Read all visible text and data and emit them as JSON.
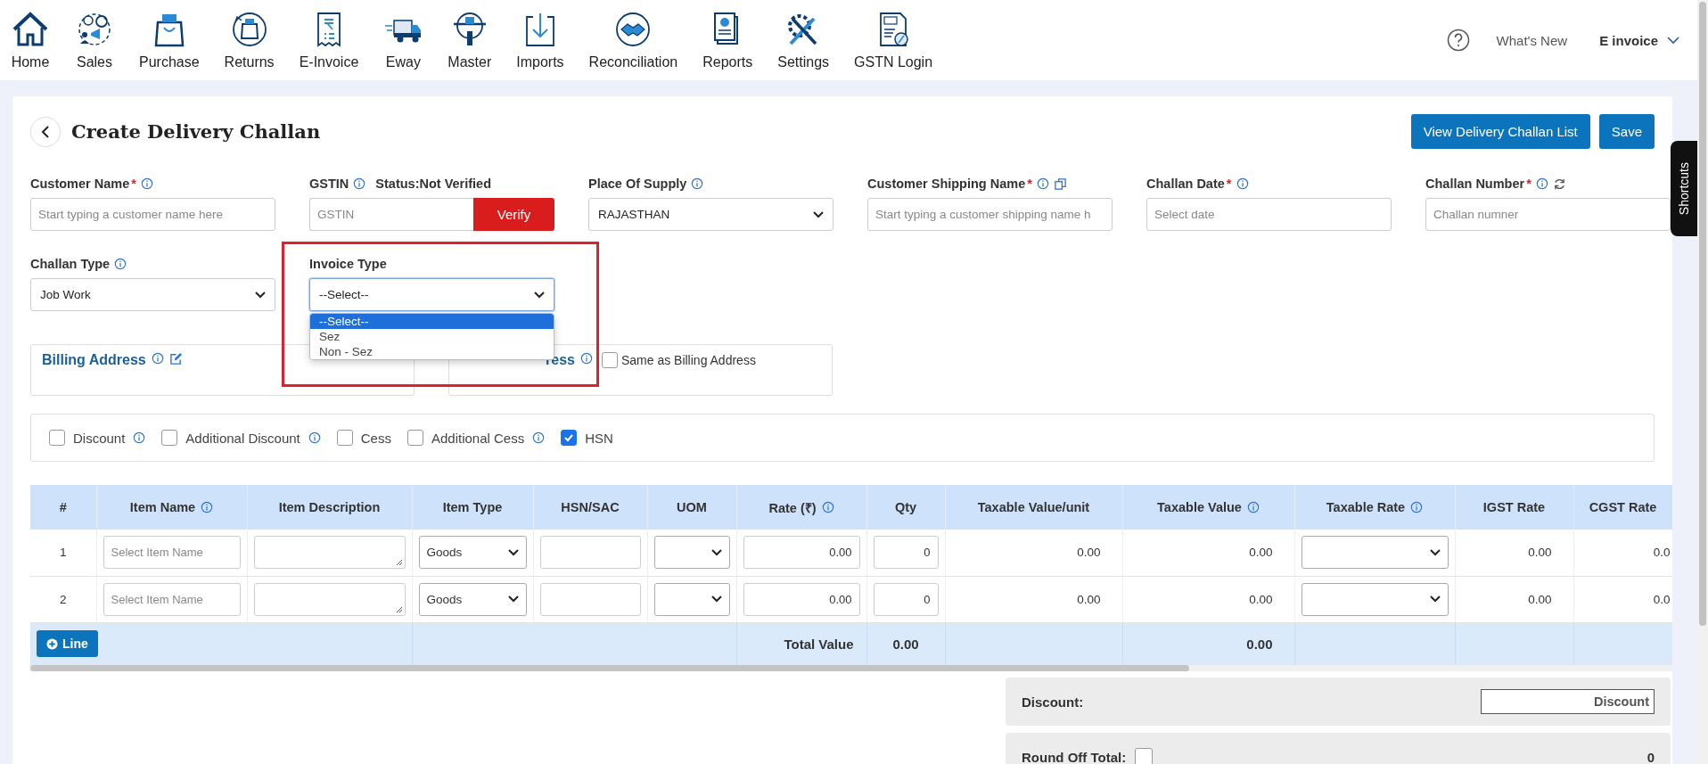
{
  "nav": {
    "items": [
      {
        "label": "Home"
      },
      {
        "label": "Sales"
      },
      {
        "label": "Purchase"
      },
      {
        "label": "Returns"
      },
      {
        "label": "E-Invoice"
      },
      {
        "label": "Eway"
      },
      {
        "label": "Master"
      },
      {
        "label": "Imports"
      },
      {
        "label": "Reconciliation"
      },
      {
        "label": "Reports"
      },
      {
        "label": "Settings"
      },
      {
        "label": "GSTN Login"
      }
    ],
    "help_link": "What's New",
    "account": "E invoice"
  },
  "page": {
    "title": "Create Delivery Challan",
    "buttons": [
      {
        "label": "View Delivery Challan List"
      },
      {
        "label": "Save"
      }
    ]
  },
  "fields": [
    {
      "kind": "text",
      "label": "Customer Name",
      "required_mark": "*",
      "info": true,
      "placeholder": "Start typing a customer name here"
    },
    {
      "kind": "gstin",
      "label": "GSTIN",
      "info": true,
      "status": "Status:Not Verified",
      "placeholder": "GSTIN",
      "button": "Verify"
    },
    {
      "kind": "select",
      "label": "Place Of Supply",
      "info": true,
      "value": "RAJASTHAN"
    },
    {
      "kind": "text",
      "label": "Customer Shipping Name",
      "required_mark": "*",
      "info": true,
      "placeholder": "Start typing a customer shipping name h"
    },
    {
      "kind": "text",
      "label": "Challan Date",
      "required_mark": "*",
      "info": true,
      "placeholder": "Select date"
    },
    {
      "kind": "text",
      "label": "Challan Number",
      "required_mark": "*",
      "info": true,
      "placeholder": "Challan numner"
    },
    {
      "kind": "select",
      "label": "Challan Type",
      "info": true,
      "value": "Job Work"
    },
    {
      "kind": "select",
      "label": "Invoice Type",
      "info": false,
      "value": "--Select--",
      "highlighted": true,
      "options": [
        {
          "label": "--Select--",
          "selected": true
        },
        {
          "label": "Sez",
          "selected": false
        },
        {
          "label": "Non - Sez",
          "selected": false
        }
      ]
    }
  ],
  "addresses": [
    {
      "title": "Billing Address",
      "editable": true
    },
    {
      "title": "ress",
      "editable": false,
      "same_as_billing": {
        "label": "Same as Billing Address",
        "checked": false
      }
    }
  ],
  "options": [
    {
      "label": "Discount",
      "checked": false,
      "info": true
    },
    {
      "label": "Additional Discount",
      "checked": false,
      "info": true
    },
    {
      "label": "Cess",
      "checked": false,
      "info": false
    },
    {
      "label": "Additional Cess",
      "checked": false,
      "info": true
    },
    {
      "label": "HSN",
      "checked": true,
      "info": false
    }
  ],
  "table": {
    "columns": [
      {
        "label": "#",
        "info": false
      },
      {
        "label": "Item Name",
        "info": true
      },
      {
        "label": "Item Description",
        "info": false
      },
      {
        "label": "Item Type",
        "info": false
      },
      {
        "label": "HSN/SAC",
        "info": false
      },
      {
        "label": "UOM",
        "info": false
      },
      {
        "label": "Rate (₹)",
        "info": true
      },
      {
        "label": "Qty",
        "info": false
      },
      {
        "label": "Taxable Value/unit",
        "info": false
      },
      {
        "label": "Taxable Value",
        "info": true
      },
      {
        "label": "Taxable Rate",
        "info": true
      },
      {
        "label": "IGST Rate",
        "info": false
      },
      {
        "label": "CGST Rate",
        "info": false
      }
    ],
    "rows": [
      {
        "number": "1",
        "item_placeholder": "Select Item Name",
        "item_type": "Goods",
        "rate": "0.00",
        "qty": "0",
        "taxable_value_unit": "0.00",
        "taxable_value": "0.00",
        "igst_rate": "0.00",
        "cgst_rate": "0.0"
      },
      {
        "number": "2",
        "item_placeholder": "Select Item Name",
        "item_type": "Goods",
        "rate": "0.00",
        "qty": "0",
        "taxable_value_unit": "0.00",
        "taxable_value": "0.00",
        "igst_rate": "0.00",
        "cgst_rate": "0.0"
      }
    ],
    "footer": {
      "add_button": "Line",
      "total_label": "Total Value",
      "qty_total": "0.00",
      "taxable_total": "0.00"
    }
  },
  "summary": {
    "discount": {
      "label": "Discount:",
      "placeholder": "Discount"
    },
    "round_off": {
      "label": "Round Off Total:",
      "checked": false,
      "value": "0"
    }
  },
  "shortcuts": "Shortcuts"
}
